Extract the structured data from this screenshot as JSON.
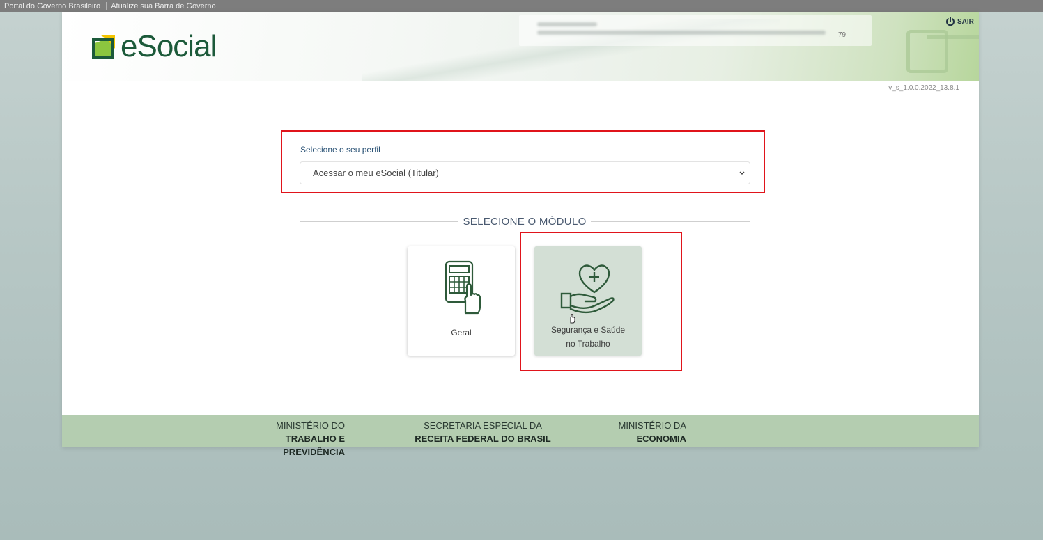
{
  "gov_bar": {
    "link1": "Portal do Governo Brasileiro",
    "link2": "Atualize sua Barra de Governo"
  },
  "header": {
    "logo_text": "eSocial",
    "user_number": "79",
    "logout_label": "SAIR",
    "logout_icon": "power-icon"
  },
  "version": "v_s_1.0.0.2022_13.8.1",
  "profile": {
    "label": "Selecione o seu perfil",
    "selected": "Acessar o meu eSocial (Titular)"
  },
  "modules": {
    "heading": "SELECIONE O MÓDULO",
    "items": [
      {
        "label": "Geral",
        "icon": "calculator-hand-icon"
      },
      {
        "label_line1": "Segurança e Saúde",
        "label_line2": "no Trabalho",
        "icon": "heart-hand-icon"
      }
    ]
  },
  "footer": {
    "mtp_line1": "MINISTÉRIO DO",
    "mtp_line2": "TRABALHO E PREVIDÊNCIA",
    "rfb_line1": "SECRETARIA ESPECIAL DA",
    "rfb_line2": "RECEITA FEDERAL DO BRASIL",
    "eco_line1": "MINISTÉRIO DA",
    "eco_line2": "ECONOMIA"
  },
  "colors": {
    "brand_green": "#1c5a3a",
    "highlight_red": "#e0141b",
    "footer_green": "#b4cdb0"
  }
}
